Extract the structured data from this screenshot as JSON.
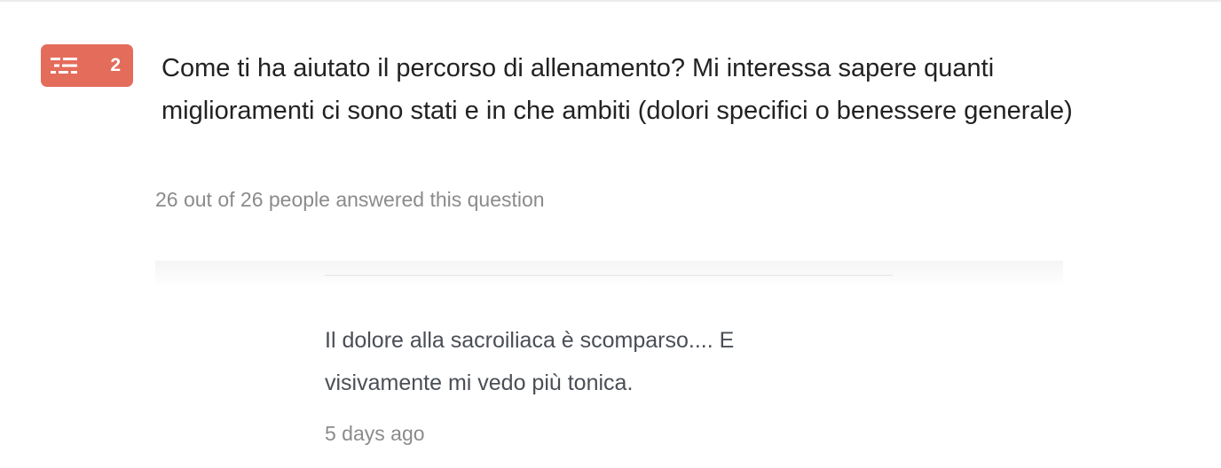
{
  "question": {
    "number": "2",
    "type_icon": "text-lines-icon",
    "badge_color": "#e46c5b",
    "title": "Come ti ha aiutato il percorso di allenamento? Mi interessa sapere quanti miglioramenti ci sono stati e in che ambiti (dolori specifici o benessere generale)",
    "response_summary": "26 out of 26 people answered this question"
  },
  "answer": {
    "text": "Il dolore alla sacroiliaca è scomparso.... E visivamente mi vedo più tonica.",
    "time": "5 days ago"
  }
}
